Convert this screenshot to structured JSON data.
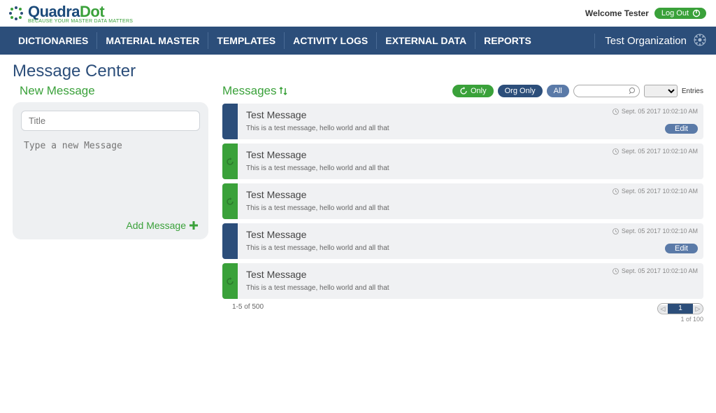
{
  "header": {
    "brand_main": "Quadra",
    "brand_accent": "Dot",
    "brand_tag": "BECAUSE YOUR MASTER DATA MATTERS",
    "welcome": "Welcome Tester",
    "logout": "Log Out"
  },
  "nav": {
    "items": [
      "DICTIONARIES",
      "MATERIAL MASTER",
      "TEMPLATES",
      "ACTIVITY LOGS",
      "EXTERNAL DATA",
      "REPORTS"
    ],
    "org": "Test Organization"
  },
  "page": {
    "title": "Message Center"
  },
  "newmsg": {
    "heading": "New Message",
    "title_placeholder": "Title",
    "body_placeholder": "Type a new Message",
    "add_label": "Add Message"
  },
  "messages": {
    "heading": "Messages",
    "filter_only": "Only",
    "filter_org": "Org Only",
    "filter_all": "All",
    "entries_label": "Entries",
    "range_label": "1-5 of 500",
    "page_current": "1",
    "page_total": "1 of 100",
    "edit_label": "Edit",
    "items": [
      {
        "stripe": "navy",
        "subject": "Test Message",
        "body": "This is a test message, hello world and all that",
        "timestamp": "Sept. 05 2017 10:02:10 AM",
        "editable": true,
        "icon": false
      },
      {
        "stripe": "green",
        "subject": "Test Message",
        "body": "This is a test message, hello world and all that",
        "timestamp": "Sept. 05 2017 10:02:10 AM",
        "editable": false,
        "icon": true
      },
      {
        "stripe": "green",
        "subject": "Test Message",
        "body": "This is a test message, hello world and all that",
        "timestamp": "Sept. 05 2017 10:02:10 AM",
        "editable": false,
        "icon": true
      },
      {
        "stripe": "navy",
        "subject": "Test Message",
        "body": "This is a test message, hello world and all that",
        "timestamp": "Sept. 05 2017 10:02:10 AM",
        "editable": true,
        "icon": false
      },
      {
        "stripe": "green",
        "subject": "Test Message",
        "body": "This is a test message, hello world and all that",
        "timestamp": "Sept. 05 2017 10:02:10 AM",
        "editable": false,
        "icon": true
      }
    ]
  }
}
